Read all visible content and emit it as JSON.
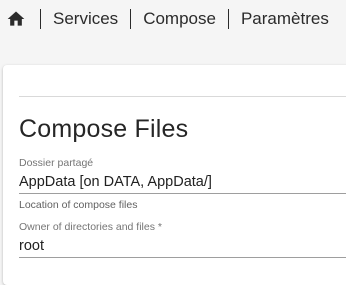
{
  "nav": {
    "home_icon": "home-icon",
    "crumbs": [
      "Services",
      "Compose",
      "Paramètres"
    ]
  },
  "form": {
    "title": "Compose Files",
    "shared_folder": {
      "label": "Dossier partagé",
      "value": "AppData [on DATA, AppData/]",
      "hint": "Location of compose files"
    },
    "owner": {
      "label": "Owner of directories and files *",
      "value": "root"
    }
  }
}
